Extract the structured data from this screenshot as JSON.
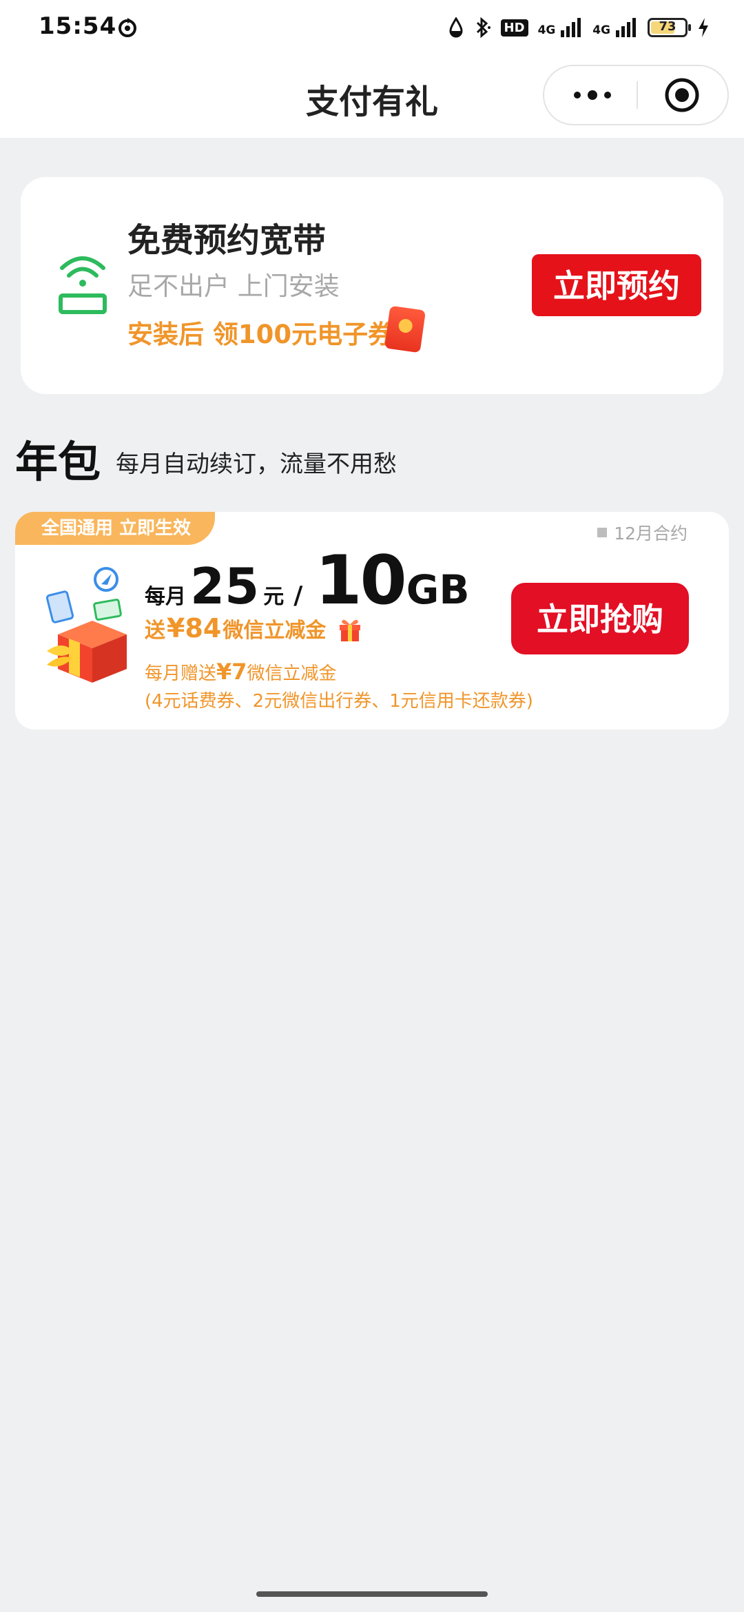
{
  "status_bar": {
    "time": "15:54",
    "icons": [
      "sync-icon",
      "drop-icon",
      "bluetooth-icon",
      "hd-voice-icon",
      "signal-4g-icon",
      "signal-4g-icon",
      "battery-icon",
      "charging-icon"
    ],
    "hd_label": "HD",
    "network_1": "4G",
    "network_2": "4G",
    "battery_level": "73",
    "battery_fraction": 0.73
  },
  "nav": {
    "title": "支付有礼",
    "more_icon": "more-dots-icon",
    "close_icon": "target-close-icon"
  },
  "broadband": {
    "title": "免费预约宽带",
    "subtitle": "足不出户 上门安装",
    "promo": "安装后 领100元电子券",
    "button": "立即预约",
    "icon": "wifi-router-icon",
    "accent_color": "#f0952a",
    "button_color": "#e5121a"
  },
  "section": {
    "title": "年包",
    "subtitle": "每月自动续订，流量不用愁"
  },
  "product": {
    "tag": "全国通用 立即生效",
    "contract": "12月合约",
    "price_prefix": "每月",
    "price": "25",
    "price_unit": "元",
    "slash": "/",
    "data_amount": "10",
    "data_unit": "GB",
    "gift_prefix": "送",
    "gift_amount": "¥84",
    "gift_suffix": "微信立减金",
    "monthly_prefix": "每月赠送",
    "monthly_amount": "¥7",
    "monthly_suffix": "微信立减金",
    "detail": "(4元话费券、2元微信出行券、1元信用卡还款券)",
    "button": "立即抢购",
    "tag_color": "#f9b65c",
    "button_color": "#e20f25"
  }
}
